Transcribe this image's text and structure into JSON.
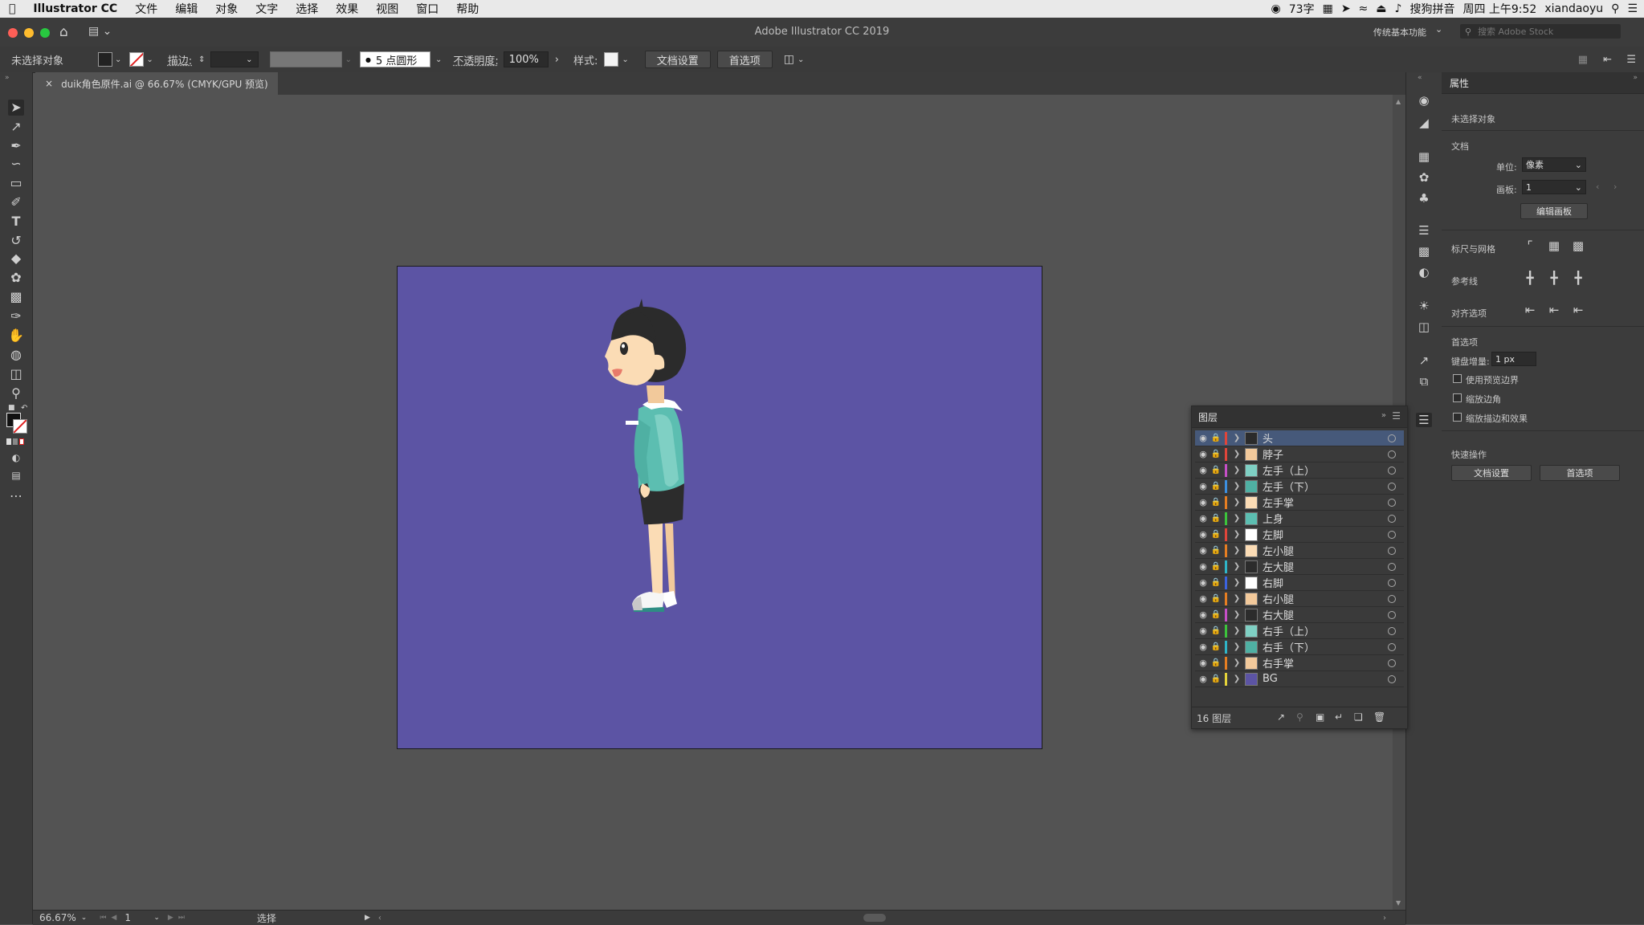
{
  "menubar": {
    "apple": "",
    "app_name": "Illustrator CC",
    "items": [
      "文件",
      "编辑",
      "对象",
      "文字",
      "选择",
      "效果",
      "视图",
      "窗口",
      "帮助"
    ],
    "status": {
      "battery_text": "73字",
      "input_method": "搜狗拼音",
      "datetime": "周四 上午9:52",
      "user": "xiandaoyu"
    }
  },
  "titlebar": {
    "title": "Adobe Illustrator CC 2019",
    "workspace": "传统基本功能",
    "search_placeholder": "搜索 Adobe Stock"
  },
  "controlbar": {
    "selection_label": "未选择对象",
    "stroke_label": "描边:",
    "brush_label": "5 点圆形",
    "opacity_label": "不透明度:",
    "opacity_value": "100%",
    "style_label": "样式:",
    "doc_setup_button": "文档设置",
    "preferences_button": "首选项"
  },
  "document_tab": {
    "close": "×",
    "title": "duik角色原件.ai @ 66.67% (CMYK/GPU 预览)"
  },
  "statusbar": {
    "zoom": "66.67%",
    "artboard_number": "1",
    "tool_status": "选择"
  },
  "properties": {
    "title": "属性",
    "no_selection": "未选择对象",
    "document_section": "文档",
    "units_label": "单位:",
    "units_value": "像素",
    "artboard_label": "画板:",
    "artboard_value": "1",
    "edit_artboard_button": "编辑画板",
    "rulers_grids_label": "标尺与网格",
    "guides_label": "参考线",
    "align_options_label": "对齐选项",
    "preferences_section": "首选项",
    "keyboard_increment_label": "键盘增量:",
    "keyboard_increment_value": "1 px",
    "checkbox_preview_bounds": "使用预览边界",
    "checkbox_scale_corners": "缩放边角",
    "checkbox_scale_strokes": "缩放描边和效果",
    "quick_actions_section": "快速操作",
    "quick_doc_setup_button": "文档设置",
    "quick_preferences_button": "首选项"
  },
  "layers": {
    "title": "图层",
    "count_label": "16 图层",
    "items": [
      {
        "name": "头",
        "color": "#e0453a",
        "selected": true
      },
      {
        "name": "脖子",
        "color": "#e0453a",
        "selected": false
      },
      {
        "name": "左手（上）",
        "color": "#c64fc7",
        "selected": false
      },
      {
        "name": "左手（下）",
        "color": "#3c8fe0",
        "selected": false
      },
      {
        "name": "左手掌",
        "color": "#e67e22",
        "selected": false
      },
      {
        "name": "上身",
        "color": "#3cc43c",
        "selected": false
      },
      {
        "name": "左脚",
        "color": "#e0453a",
        "selected": false
      },
      {
        "name": "左小腿",
        "color": "#e67e22",
        "selected": false
      },
      {
        "name": "左大腿",
        "color": "#2fb5c8",
        "selected": false
      },
      {
        "name": "右脚",
        "color": "#3c63e0",
        "selected": false
      },
      {
        "name": "右小腿",
        "color": "#e67e22",
        "selected": false
      },
      {
        "name": "右大腿",
        "color": "#c64fc7",
        "selected": false
      },
      {
        "name": "右手（上）",
        "color": "#3cc43c",
        "selected": false
      },
      {
        "name": "右手（下）",
        "color": "#2fb5c8",
        "selected": false
      },
      {
        "name": "右手掌",
        "color": "#e67e22",
        "selected": false
      },
      {
        "name": "BG",
        "color": "#e5d43a",
        "selected": false
      }
    ]
  },
  "artboard": {
    "background_color": "#5c54a4"
  }
}
